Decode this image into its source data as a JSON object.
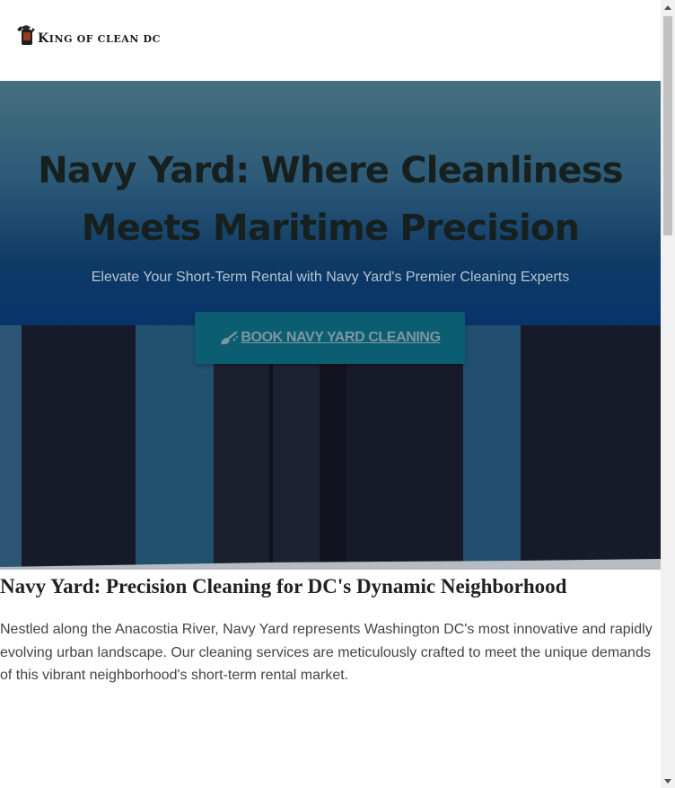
{
  "header": {
    "logo_text_lead": "K",
    "logo_text_rest": "ING OF CLEAN DC"
  },
  "hero": {
    "title": "Navy Yard: Where Cleanliness Meets Maritime Precision",
    "subtitle": "Elevate Your Short-Term Rental with Navy Yard's Premier Cleaning Experts",
    "cta_label": "BOOK NAVY YARD CLEANING",
    "cta_icon": "broom-icon"
  },
  "content": {
    "title": "Navy Yard: Precision Cleaning for DC's Dynamic Neighborhood",
    "body": "Nestled along the Anacostia River, Navy Yard represents Washington DC's most innovative and rapidly evolving urban landscape. Our cleaning services are meticulously crafted to meet the unique demands of this vibrant neighborhood's short-term rental market."
  },
  "colors": {
    "cta_background": "#0b5d72",
    "hero_gradient_bottom": "#07336a",
    "hero_title": "#16201e"
  }
}
